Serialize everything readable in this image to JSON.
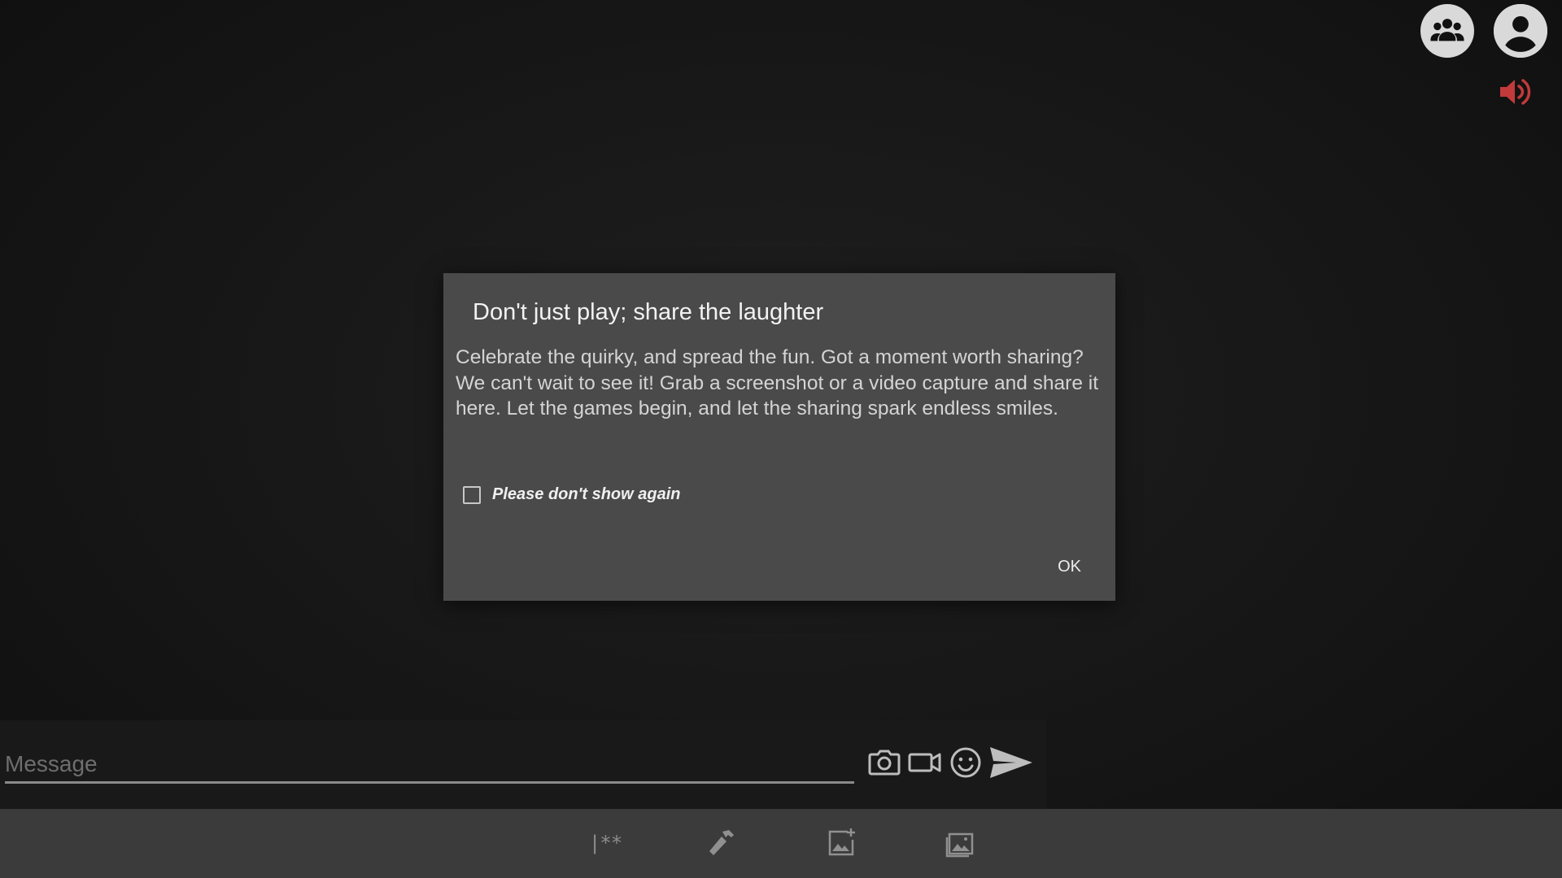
{
  "header": {
    "group_icon": "group-icon",
    "profile_icon": "account-circle-icon",
    "sound_icon": "volume-up-icon",
    "sound_color": "#c23a3a"
  },
  "dialog": {
    "title": "Don't just play; share the laughter",
    "body": "Celebrate the quirky, and spread the fun. Got a moment worth sharing? We can't wait to see it! Grab a screenshot or a video capture and share it here. Let the games begin, and let the sharing spark endless smiles.",
    "checkbox_label": "Please don't show again",
    "checkbox_checked": false,
    "ok_label": "OK"
  },
  "message_bar": {
    "placeholder": "Message",
    "value": "",
    "icons": [
      "camera-icon",
      "video-camera-icon",
      "emoji-icon",
      "send-icon"
    ]
  },
  "toolbar": {
    "stars_label": "|**",
    "icons": [
      "rating-stars-icon",
      "hammer-icon",
      "add-image-icon",
      "gallery-icon"
    ]
  }
}
